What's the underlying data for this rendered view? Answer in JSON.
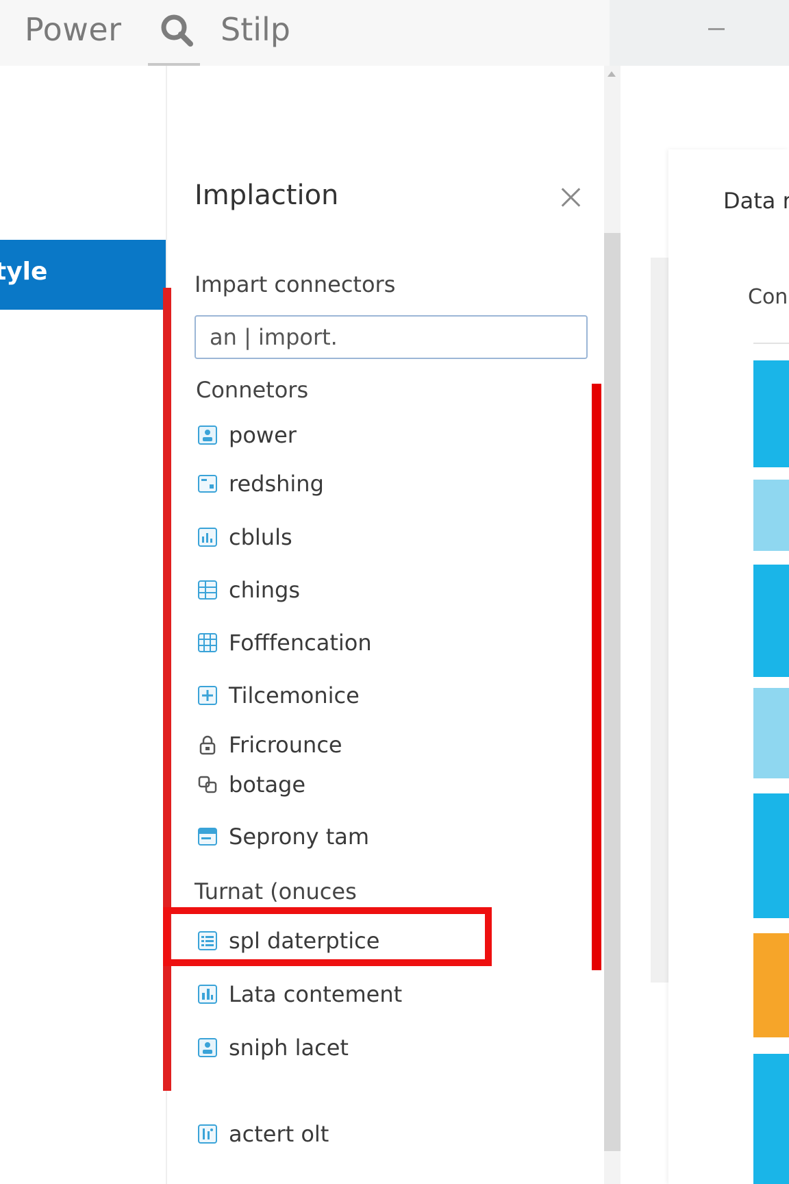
{
  "header": {
    "app_title": "Power",
    "tab_title": "Stilp"
  },
  "nav": {
    "active_item": "tyle"
  },
  "panel": {
    "title": "Implaction",
    "import_label": "Impart connectors",
    "search_value": "an | import.",
    "connectors_label": "Connetors",
    "connectors": [
      {
        "label": "power",
        "icon": "person-icon"
      },
      {
        "label": "redshing",
        "icon": "window-icon"
      },
      {
        "label": "cbluls",
        "icon": "chart-icon"
      },
      {
        "label": "chings",
        "icon": "table-icon"
      },
      {
        "label": "Fofffencation",
        "icon": "grid-icon"
      },
      {
        "label": "Tilcemonice",
        "icon": "plus-box-icon"
      },
      {
        "label": "Fricrounce",
        "icon": "lock-icon"
      },
      {
        "label": "botage",
        "icon": "link-icon"
      },
      {
        "label": "Seprony tam",
        "icon": "card-icon"
      }
    ],
    "templates_label": "Turnat (onuces",
    "templates": [
      {
        "label": "spl daterptice",
        "icon": "list-icon"
      },
      {
        "label": "Lata contement",
        "icon": "doc-chart-icon"
      },
      {
        "label": "sniph lacet",
        "icon": "person-icon"
      },
      {
        "label": "actert olt",
        "icon": "stats-icon"
      }
    ]
  },
  "right": {
    "title": "Data re",
    "subtitle": "Conr"
  },
  "colors": {
    "accent": "#0a78c7",
    "annotation": "#e50000",
    "tile_blue": "#1ab5e8",
    "tile_light": "#8fd7f0",
    "tile_orange": "#f6a529"
  }
}
